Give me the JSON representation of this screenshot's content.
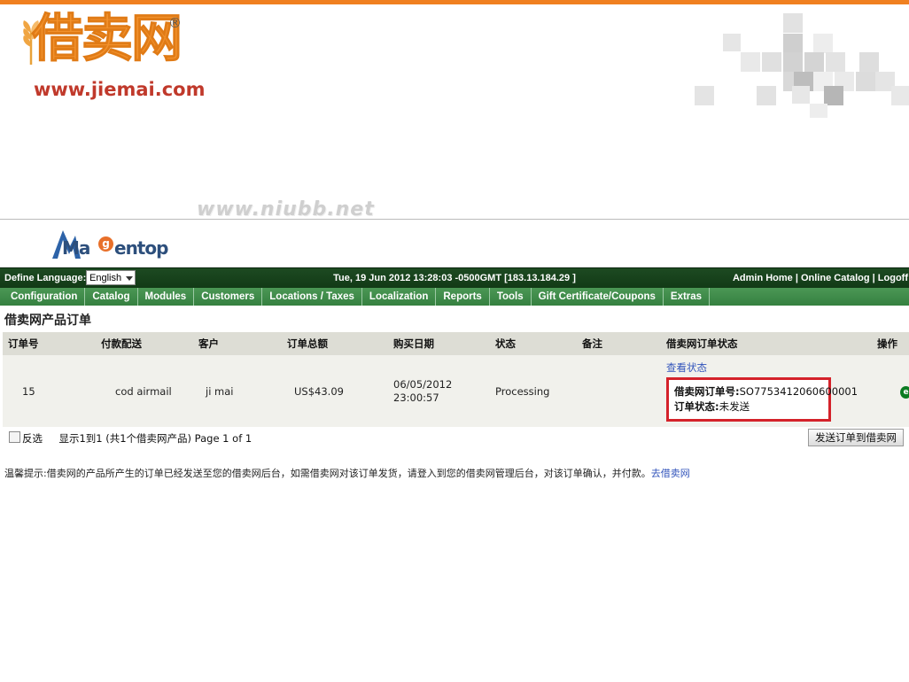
{
  "site": {
    "logo_text": "借卖网",
    "logo_registered": "®",
    "logo_url": "www.jiemai.com",
    "watermark": "www.niubb.net"
  },
  "admin": {
    "brand_name": "Ma",
    "brand_mark": "g",
    "brand_suffix": "entop",
    "language": {
      "label": "Define Language:",
      "selected": "English",
      "options": [
        "English"
      ]
    },
    "datetime": "Tue, 19 Jun 2012 13:28:03 -0500GMT [183.13.184.29 ]",
    "account_links": "Admin Home | Online Catalog | Logoff",
    "nav": [
      {
        "label": "Configuration"
      },
      {
        "label": "Catalog"
      },
      {
        "label": "Modules"
      },
      {
        "label": "Customers"
      },
      {
        "label": "Locations / Taxes"
      },
      {
        "label": "Localization"
      },
      {
        "label": "Reports"
      },
      {
        "label": "Tools"
      },
      {
        "label": "Gift Certificate/Coupons"
      },
      {
        "label": "Extras"
      }
    ]
  },
  "page": {
    "title": "借卖网产品订单",
    "table": {
      "headers": [
        "订单号",
        "付款配送",
        "客户",
        "订单总额",
        "购买日期",
        "状态",
        "备注",
        "借卖网订单状态",
        "操作"
      ],
      "rows": [
        {
          "order_id": "15",
          "shipping": "cod airmail",
          "customer": "ji mai",
          "total": "US$43.09",
          "date": "06/05/2012",
          "time": "23:00:57",
          "status": "Processing",
          "note": "",
          "view_state_link": "查看状态",
          "jm_order_no_label": "借卖网订单号:",
          "jm_order_no": "SO7753412060600001",
          "jm_status_label": "订单状态:",
          "jm_status": "未发送",
          "action_icon": "payment-icon",
          "action_icon_glyph": "e"
        }
      ]
    },
    "controls": {
      "invert_label": "反选",
      "count_text": "显示1到1 (共1个借卖网产品) Page 1 of 1",
      "send_button": "发送订单到借卖网"
    },
    "notice": {
      "text": "温馨提示:借卖网的产品所产生的订单已经发送至您的借卖网后台，如需借卖网对该订单发货，请登入到您的借卖网管理后台，对该订单确认，并付款。",
      "link": "去借卖网"
    }
  },
  "colors": {
    "top_bar": "#f08020",
    "dark_green": "#17401b",
    "nav_green": "#3f8a4a",
    "red_box": "#d4222a",
    "link_blue": "#3355bb",
    "logo_orange": "#f2912c",
    "logo_red": "#c0392b"
  }
}
